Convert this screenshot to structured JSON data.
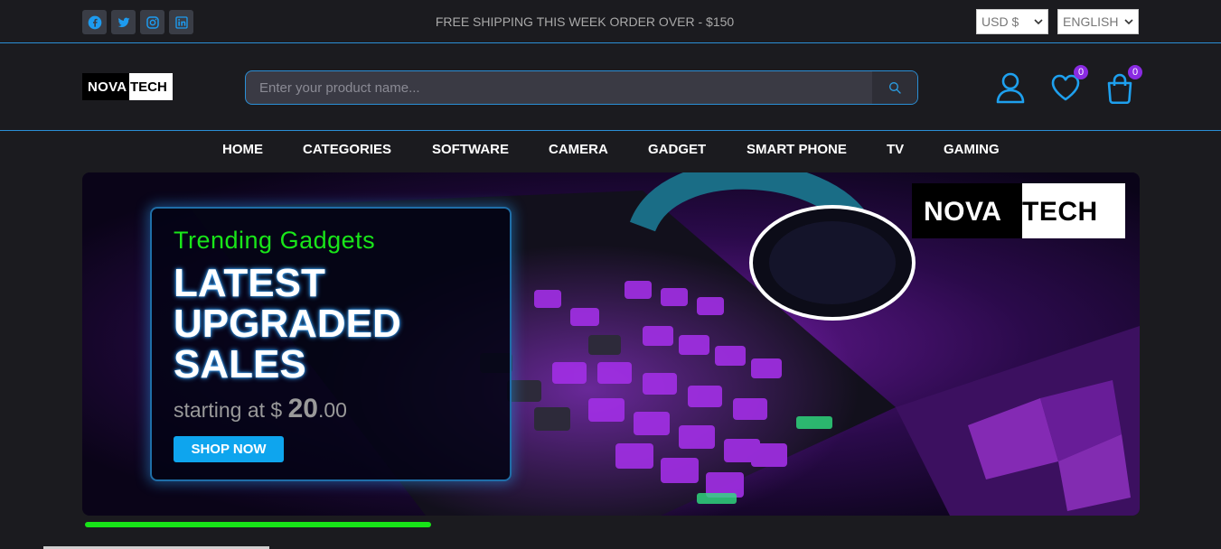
{
  "topbar": {
    "socials": [
      "facebook-icon",
      "twitter-icon",
      "instagram-icon",
      "linkedin-icon"
    ],
    "shipping_text": "FREE SHIPPING THIS WEEK ORDER OVER - $150",
    "currency": "USD $",
    "language": "ENGLISH"
  },
  "header": {
    "logo_part1": "NOVA",
    "logo_part2": "TECH",
    "search_placeholder": "Enter your product name...",
    "wishlist_count": "0",
    "cart_count": "0"
  },
  "nav": {
    "items": [
      "HOME",
      "CATEGORIES",
      "SOFTWARE",
      "CAMERA",
      "GADGET",
      "SMART PHONE",
      "TV",
      "GAMING"
    ]
  },
  "hero": {
    "logo_part1": "NOVA",
    "logo_part2": "TECH",
    "kicker": "Trending Gadgets",
    "headline": "LATEST UPGRADED SALES",
    "price_prefix": "starting at $ ",
    "price_whole": "20",
    "price_cents": ".00",
    "button_label": "SHOP NOW"
  },
  "slider": {
    "progress": 0.33
  },
  "colors": {
    "accent": "#2a8fd6",
    "badge": "#8a2be2",
    "cta": "#0ea5ee",
    "progress": "#18e418",
    "kicker": "#19e619"
  }
}
